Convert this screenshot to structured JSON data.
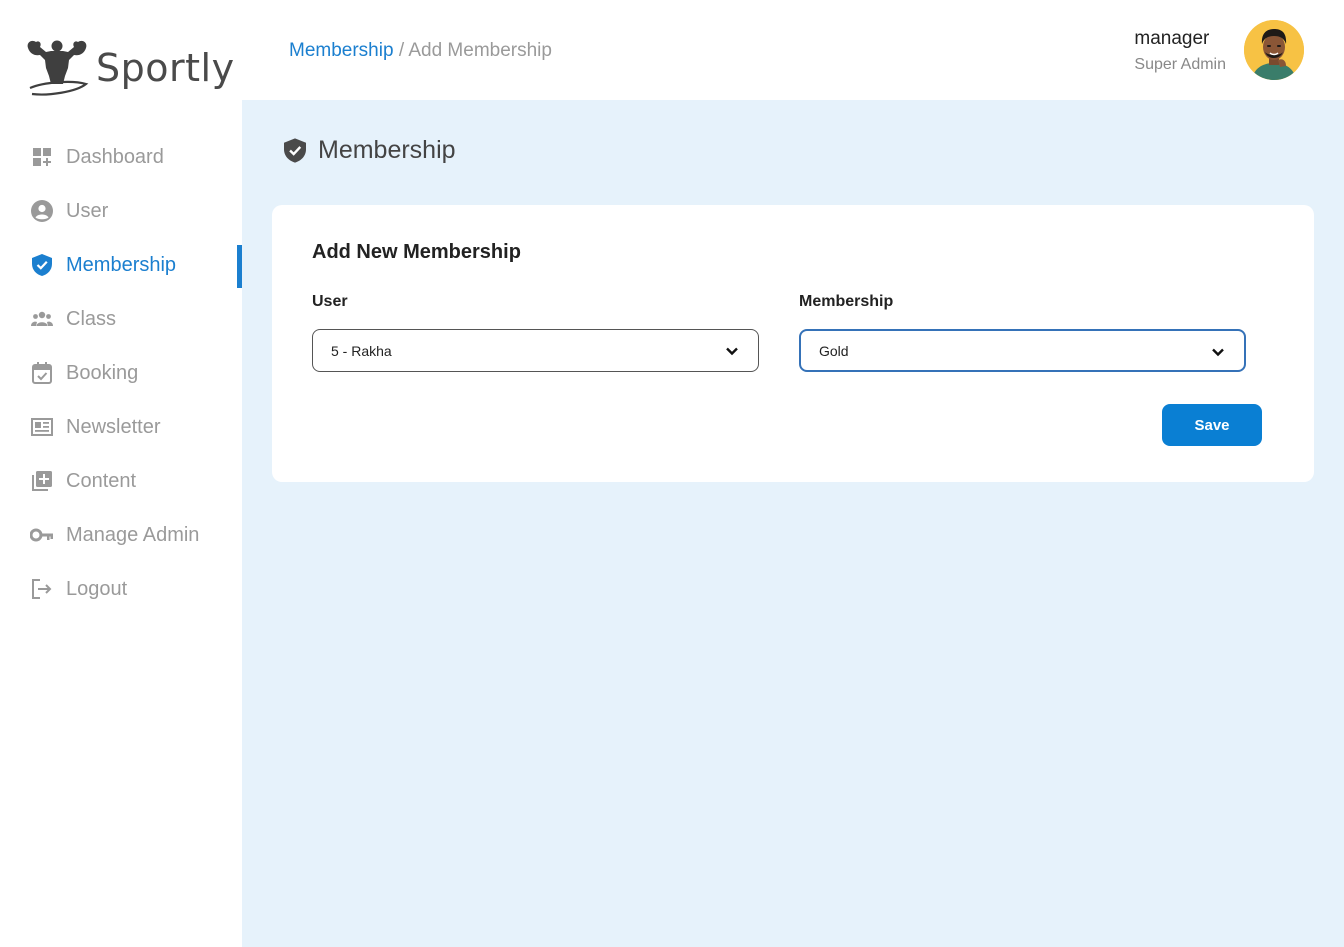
{
  "app": {
    "name": "Sportly"
  },
  "sidebar": {
    "items": [
      {
        "label": "Dashboard",
        "icon": "dashboard-icon",
        "active": false
      },
      {
        "label": "User",
        "icon": "user-circle-icon",
        "active": false
      },
      {
        "label": "Membership",
        "icon": "shield-check-icon",
        "active": true
      },
      {
        "label": "Class",
        "icon": "group-icon",
        "active": false
      },
      {
        "label": "Booking",
        "icon": "calendar-check-icon",
        "active": false
      },
      {
        "label": "Newsletter",
        "icon": "newspaper-icon",
        "active": false
      },
      {
        "label": "Content",
        "icon": "add-content-icon",
        "active": false
      },
      {
        "label": "Manage Admin",
        "icon": "key-icon",
        "active": false
      },
      {
        "label": "Logout",
        "icon": "logout-icon",
        "active": false
      }
    ]
  },
  "header": {
    "breadcrumb": {
      "parent": "Membership",
      "separator": "/",
      "current": "Add Membership"
    },
    "user": {
      "name": "manager",
      "role": "Super Admin"
    }
  },
  "main": {
    "page_title": "Membership",
    "card": {
      "title": "Add New Membership",
      "user_label": "User",
      "user_value": "5 - Rakha",
      "membership_label": "Membership",
      "membership_value": "Gold",
      "save_label": "Save"
    }
  },
  "colors": {
    "accent": "#1b7fcf",
    "button": "#0a7fd3",
    "main_background": "#e6f2fb",
    "muted_text": "#9a9a9a",
    "avatar_background": "#f7c244"
  }
}
